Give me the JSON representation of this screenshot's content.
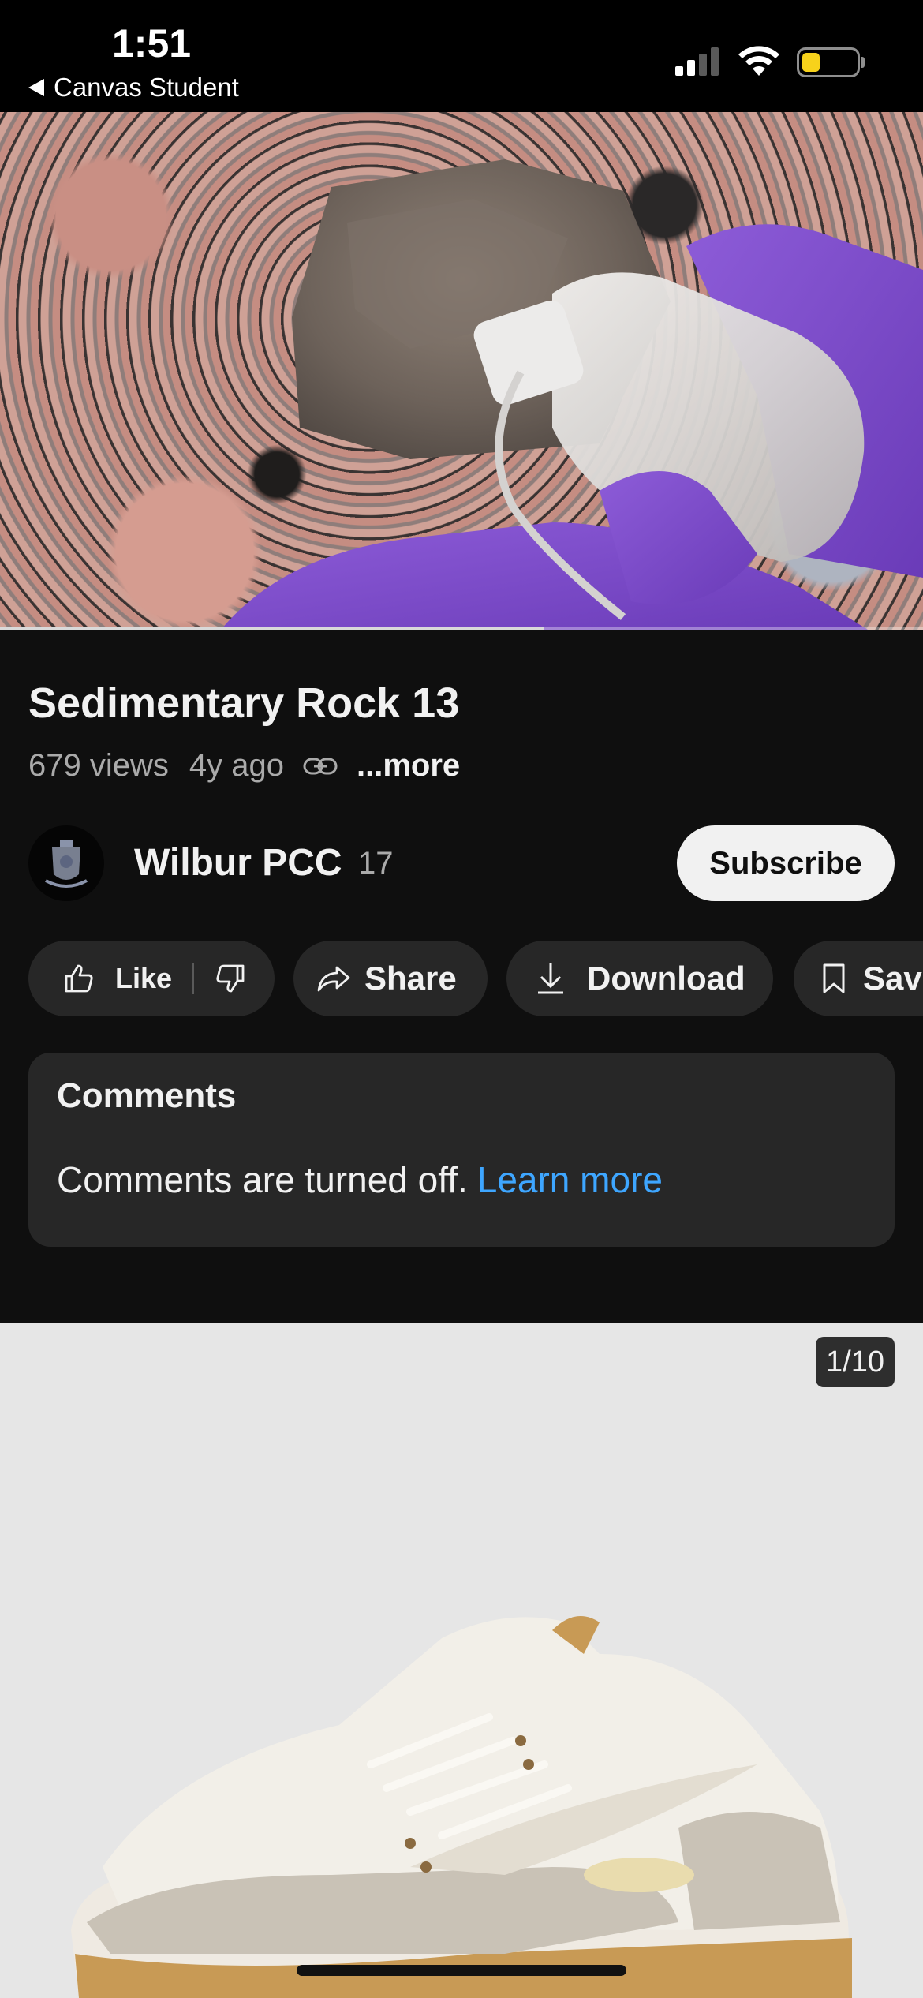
{
  "status_bar": {
    "time": "1:51",
    "back_app": "Canvas Student",
    "battery_color": "#f7d21b"
  },
  "video": {
    "progress": 0.59,
    "progress_color": "#d9d9d9",
    "icon": "video-player"
  },
  "info": {
    "title": "Sedimentary Rock 13",
    "views": "679 views",
    "ago": "4y ago",
    "more": "...more"
  },
  "channel": {
    "name": "Wilbur PCC",
    "subscriber_count": "17",
    "subscribe_label": "Subscribe"
  },
  "actions": {
    "like": "Like",
    "share": "Share",
    "download": "Download",
    "save": "Save"
  },
  "comments": {
    "title": "Comments",
    "text": "Comments are turned off.",
    "learn_more": "Learn more",
    "link_color": "#3ea6ff"
  },
  "ad": {
    "counter": "1/10",
    "image": "sneaker-photo"
  },
  "colors": {
    "background": "#0f0f0f",
    "pill": "#272727",
    "text": "#f1f1f1",
    "secondary_text": "#aaaaaa"
  }
}
